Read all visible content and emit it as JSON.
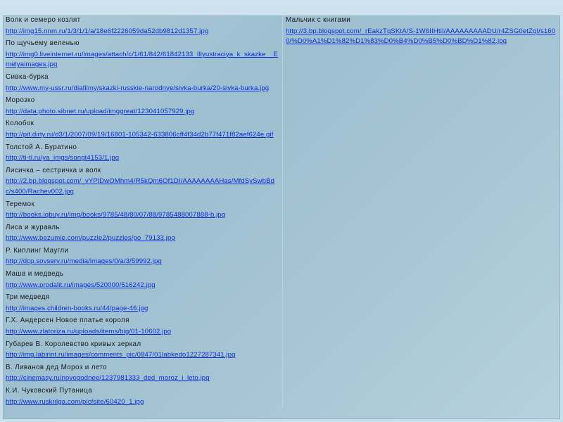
{
  "left_items": [
    {
      "title": "Волк и семеро козлят",
      "url": "http://img15.nnm.ru/1/3/1/1/a/18e6f2226059da52db9812d1357.jpg"
    },
    {
      "title": "По щучьему веленью",
      "url": "http://img0.liveinternet.ru/images/attach/c/1/61/842/61842133_Illyustraciya_k_skazke__Emelyaimages.jpg"
    },
    {
      "title": "Сивка-бурка",
      "url": "http://www.my-ussr.ru/diafilmy/skazki-russkie-narodnye/sivka-burka/20-sivka-burka.jpg"
    },
    {
      "title": "Морозко",
      "url": "http://data.photo.sibnet.ru/upload/imggreat/123041057929.jpg"
    },
    {
      "title": "Колобок",
      "url": "http://pit.dirty.ru/d3/1/2007/09/19/16801-105342-633806cff4f34d2b77f471f82aef624e.gif"
    },
    {
      "title": "Толстой А. Буратино",
      "url": "http://ti-ti.ru/ya_imgs/songt4153/1.jpg"
    },
    {
      "title": "Лисичка – сестричка и волк",
      "url": "http://2.bp.blogspot.com/_vYPlDwOMhm4/R5kQm6Of1DI/AAAAAAAAHas/MfdSySwbBdc/s400/Rachev002.jpg"
    },
    {
      "title": "Теремок",
      "url": "http://books.iqbuy.ru/img/books/9785/48/80/07/88/9785488007888-b.jpg"
    },
    {
      "title": "Лиса и журавль",
      "url": "http://www.bezumie.com/puzzle2/puzzles/po_79133.jpg"
    },
    {
      "title": "Р. Киплинг Маугли",
      "url": "http://dcp.sovserv.ru/media/images/0/a/3/59992.jpg"
    },
    {
      "title": "Маша и медведь",
      "url": "http://www.prodalit.ru/images/520000/516242.jpg"
    },
    {
      "title": "Три медведя",
      "url": "http://images.children-books.ru/44/page-46.jpg"
    },
    {
      "title": "Г.Х. Андерсен Новое платье короля",
      "url": "http://www.zlatoriza.ru/uploads/items/big/01-10602.jpg"
    },
    {
      "title": "Губарев В. Королевство кривых зеркал",
      "url": "http://img.labirint.ru/images/comments_pic/0847/01labkedo1227287341.jpg"
    },
    {
      "title": "В. Ливанов дед Мороз и лето",
      "url": "http://cinemasy.ru/novogodnee/1237981333_ded_moroz_i_leto.jpg"
    },
    {
      "title": "К.И. Чуковский Путаница",
      "url": "http://www.rusknlga.com/picfsite/60420_1.jpg"
    }
  ],
  "right_items": [
    {
      "title": "Мальчик с книгами",
      "url": "http://3.bp.blogspot.com/_rEakzTqSKtA/S-1W6IIHtiI/AAAAAAAAADU/r4ZSG0etZqI/s1600/%D0%A1%D1%82%D1%83%D0%B4%D0%B5%D0%BD%D1%82.jpg"
    }
  ]
}
